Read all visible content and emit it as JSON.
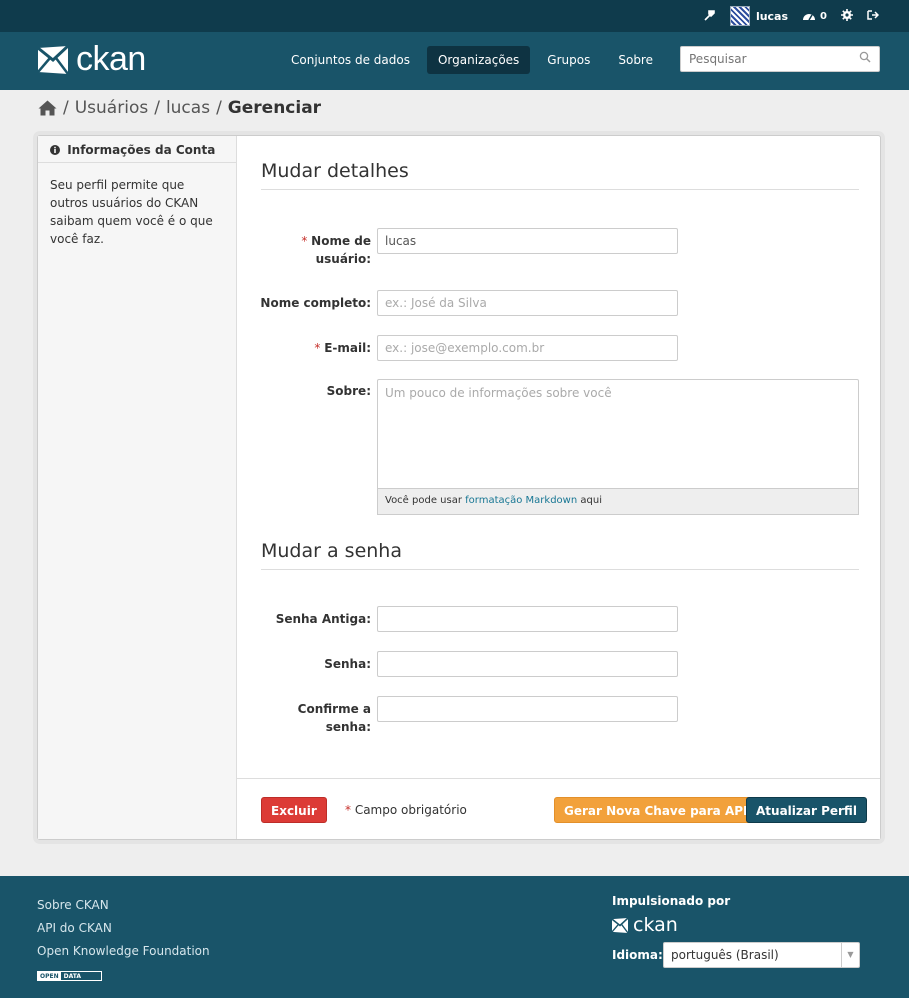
{
  "account": {
    "username": "lucas",
    "dashboard_count": "0"
  },
  "header": {
    "logo_text": "ckan",
    "nav": [
      {
        "label": "Conjuntos de dados"
      },
      {
        "label": "Organizações"
      },
      {
        "label": "Grupos"
      },
      {
        "label": "Sobre"
      }
    ],
    "active_nav": "Organizações",
    "search_placeholder": "Pesquisar"
  },
  "breadcrumb": {
    "items": [
      "Usuários",
      "lucas"
    ],
    "current": "Gerenciar"
  },
  "sidebar": {
    "title": "Informações da Conta",
    "text": "Seu perfil permite que outros usuários do CKAN saibam quem você é o que você faz."
  },
  "form": {
    "details_title": "Mudar detalhes",
    "username_label": "Nome de usuário:",
    "username_value": "lucas",
    "fullname_label": "Nome completo:",
    "fullname_placeholder": "ex.: José da Silva",
    "email_label": "E-mail:",
    "email_placeholder": "ex.: jose@exemplo.com.br",
    "about_label": "Sobre:",
    "about_placeholder": "Um pouco de informações sobre você",
    "markdown_prefix": "Você pode usar",
    "markdown_link": "formatação Markdown",
    "markdown_suffix": "aqui",
    "password_title": "Mudar a senha",
    "old_password_label": "Senha Antiga:",
    "password_label": "Senha:",
    "confirm_label": "Confirme a senha:"
  },
  "actions": {
    "delete": "Excluir",
    "required_note": "Campo obrigatório",
    "regen_key": "Gerar Nova Chave para API",
    "update": "Atualizar Perfil"
  },
  "footer": {
    "links": [
      "Sobre CKAN",
      "API do CKAN",
      "Open Knowledge Foundation"
    ],
    "open_data_a": "OPEN",
    "open_data_b": "DATA",
    "powered_by": "Impulsionado por",
    "logo_text": "ckan",
    "language_label": "Idioma:",
    "language_value": "português (Brasil)"
  },
  "colors": {
    "brand": "#195469",
    "account_bar": "#0f3b4c",
    "danger": "#dc3b36",
    "warning": "#f2a13b"
  }
}
